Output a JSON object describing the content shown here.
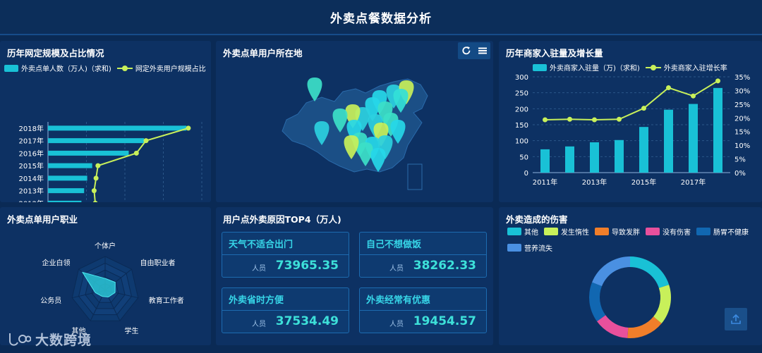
{
  "header": {
    "title": "外卖点餐数据分析"
  },
  "panel1": {
    "title": "历年网定规模及占比情况",
    "legend": {
      "bar": "外卖点单人数（万人)（求和)",
      "line": "网定外卖用户规模占比"
    },
    "colors": {
      "bar": "#19c1d6",
      "line": "#c8f05a"
    },
    "chart_data": {
      "type": "bar",
      "orientation": "horizontal",
      "categories": [
        "2011年",
        "2012年",
        "2013年",
        "2014年",
        "2015年",
        "2016年",
        "2017年",
        "2018年"
      ],
      "series": [
        {
          "name": "外卖点单人数（万人)（求和)",
          "type": "bar",
          "values": [
            6500,
            8700,
            9400,
            10200,
            11500,
            21000,
            25000,
            36000
          ]
        },
        {
          "name": "网定外卖用户规模占比",
          "type": "line",
          "values": [
            10000,
            12300,
            12000,
            12500,
            13000,
            23000,
            25500,
            36500
          ]
        }
      ],
      "xticks": [
        "0",
        "10000",
        "20000",
        "30000",
        "40000"
      ],
      "xlim": [
        0,
        40000
      ]
    }
  },
  "panel2": {
    "title": "外卖点单用户所在地",
    "toolbar": {
      "refresh_icon": "refresh-icon",
      "menu_icon": "menu-icon"
    }
  },
  "panel3": {
    "title": "历年商家入驻量及增长量",
    "legend": {
      "bar": "外卖商家入驻量（万)（求和)",
      "line": "外卖商家入驻增长率"
    },
    "colors": {
      "bar": "#19c1d6",
      "line": "#c8f05a"
    },
    "chart_data": {
      "type": "bar",
      "categories": [
        "2011年",
        "2012年",
        "2013年",
        "2014年",
        "2015年",
        "2016年",
        "2017年",
        "2018年"
      ],
      "xtick_labels": [
        "2011年",
        "2013年",
        "2015年",
        "2017年"
      ],
      "series": [
        {
          "name": "外卖商家入驻量（万)（求和)",
          "type": "bar",
          "axis": "left",
          "values": [
            73,
            82,
            95,
            102,
            143,
            197,
            215,
            265
          ]
        },
        {
          "name": "外卖商家入驻增长率",
          "type": "line",
          "axis": "right",
          "values": [
            19.3,
            19.5,
            19.3,
            19.5,
            23.5,
            31,
            28,
            33.5
          ]
        }
      ],
      "ylim_left": [
        0,
        300
      ],
      "yticks_left": [
        "0",
        "50",
        "100",
        "150",
        "200",
        "250",
        "300"
      ],
      "ylim_right": [
        0,
        35
      ],
      "yticks_right": [
        "0%",
        "5%",
        "10%",
        "15%",
        "20%",
        "25%",
        "30%",
        "35%"
      ]
    }
  },
  "panel4": {
    "title": "外卖点单用户职业",
    "chart_data": {
      "type": "radar",
      "indicators": [
        "个体户",
        "自由职业者",
        "教育工作者",
        "学生",
        "其他",
        "公务员",
        "企业白领"
      ],
      "values": [
        0.35,
        0.38,
        0.3,
        0.22,
        0.2,
        0.3,
        0.85
      ]
    }
  },
  "panel5": {
    "title": "用户点外卖原因TOP4（万人)",
    "cards": [
      {
        "title": "天气不适合出门",
        "label": "人员",
        "value": "73965.35"
      },
      {
        "title": "自己不想做饭",
        "label": "人员",
        "value": "38262.33"
      },
      {
        "title": "外卖省时方便",
        "label": "人员",
        "value": "37534.49"
      },
      {
        "title": "外卖经常有优惠",
        "label": "人员",
        "value": "19454.57"
      }
    ]
  },
  "panel6": {
    "title": "外卖造成的伤害",
    "chart_data": {
      "type": "pie",
      "donut": true,
      "labels": [
        "其他",
        "发生惰性",
        "导致发胖",
        "没有伤害",
        "肠胃不健康",
        "营养流失"
      ],
      "colors": [
        "#19c1d6",
        "#c8f05a",
        "#f07e2a",
        "#e8509c",
        "#1167b1",
        "#4a90e2"
      ],
      "values": [
        20,
        16,
        15,
        14,
        16,
        19
      ]
    }
  },
  "watermark": {
    "text": "大数跨境"
  }
}
